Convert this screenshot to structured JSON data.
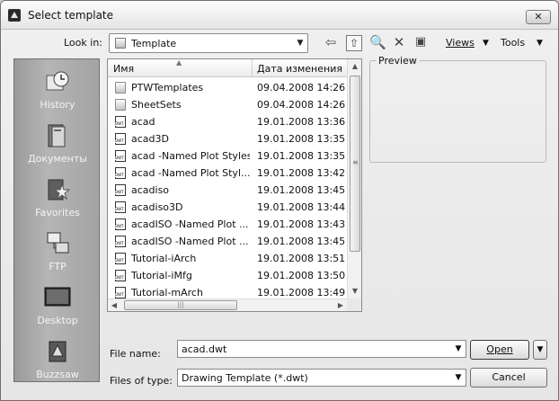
{
  "window": {
    "title": "Select template",
    "close_label": "✕"
  },
  "toolbar": {
    "look_in_label": "Look in:",
    "look_in_value": "Template",
    "views_label": "Views",
    "tools_label": "Tools",
    "icons": [
      "back-arrow-icon",
      "up-folder-icon",
      "search-web-icon",
      "delete-icon",
      "create-folder-icon"
    ]
  },
  "places": [
    {
      "label": "History",
      "icon": "history-icon"
    },
    {
      "label": "Документы",
      "icon": "documents-icon"
    },
    {
      "label": "Favorites",
      "icon": "favorites-icon"
    },
    {
      "label": "FTP",
      "icon": "ftp-icon"
    },
    {
      "label": "Desktop",
      "icon": "desktop-icon"
    },
    {
      "label": "Buzzsaw",
      "icon": "buzzsaw-icon"
    }
  ],
  "file_list": {
    "columns": {
      "name": "Имя",
      "date": "Дата изменения"
    },
    "rows": [
      {
        "name": "PTWTemplates",
        "date": "09.04.2008 14:26",
        "type": "folder"
      },
      {
        "name": "SheetSets",
        "date": "09.04.2008 14:26",
        "type": "folder"
      },
      {
        "name": "acad",
        "date": "19.01.2008 13:36",
        "type": "dwt"
      },
      {
        "name": "acad3D",
        "date": "19.01.2008 13:35",
        "type": "dwt"
      },
      {
        "name": "acad -Named Plot Styles",
        "date": "19.01.2008 13:35",
        "type": "dwt"
      },
      {
        "name": "acad -Named Plot Styl...",
        "date": "19.01.2008 13:42",
        "type": "dwt"
      },
      {
        "name": "acadiso",
        "date": "19.01.2008 13:45",
        "type": "dwt"
      },
      {
        "name": "acadiso3D",
        "date": "19.01.2008 13:44",
        "type": "dwt"
      },
      {
        "name": "acadISO -Named Plot ...",
        "date": "19.01.2008 13:43",
        "type": "dwt"
      },
      {
        "name": "acadISO -Named Plot ...",
        "date": "19.01.2008 13:45",
        "type": "dwt"
      },
      {
        "name": "Tutorial-iArch",
        "date": "19.01.2008 13:51",
        "type": "dwt"
      },
      {
        "name": "Tutorial-iMfg",
        "date": "19.01.2008 13:50",
        "type": "dwt"
      },
      {
        "name": "Tutorial-mArch",
        "date": "19.01.2008 13:49",
        "type": "dwt"
      }
    ]
  },
  "preview": {
    "label": "Preview"
  },
  "file_name": {
    "label": "File name:",
    "value": "acad.dwt"
  },
  "files_of_type": {
    "label": "Files of type:",
    "value": "Drawing Template (*.dwt)"
  },
  "buttons": {
    "open": "Open",
    "cancel": "Cancel"
  }
}
